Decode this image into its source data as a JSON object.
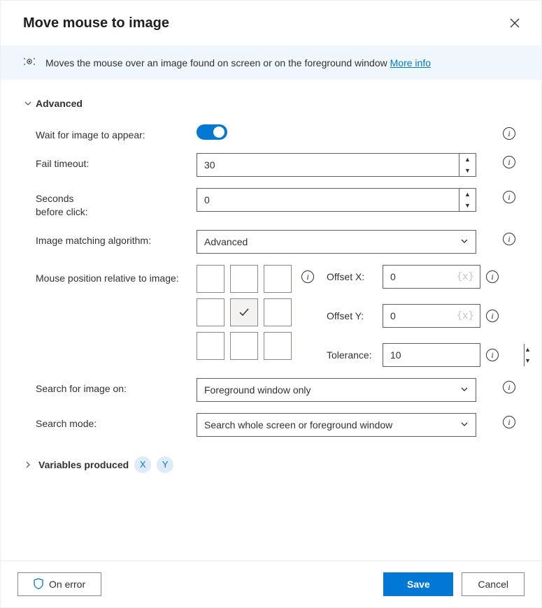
{
  "header": {
    "title": "Move mouse to image"
  },
  "info": {
    "text": "Moves the mouse over an image found on screen or on the foreground window",
    "link_text": "More info"
  },
  "sections": {
    "advanced": "Advanced",
    "variables_produced": "Variables produced"
  },
  "labels": {
    "wait_for_image": "Wait for image to appear:",
    "fail_timeout": "Fail timeout:",
    "seconds_before_click": "Seconds\nbefore click:",
    "image_matching_algorithm": "Image matching algorithm:",
    "mouse_position": "Mouse position relative to image:",
    "offset_x": "Offset X:",
    "offset_y": "Offset Y:",
    "tolerance": "Tolerance:",
    "search_on": "Search for image on:",
    "search_mode": "Search mode:",
    "var_placeholder": "{x}"
  },
  "values": {
    "wait_for_image": true,
    "fail_timeout": "30",
    "seconds_before_click": "0",
    "image_matching_algorithm": "Advanced",
    "mouse_position_index": 4,
    "offset_x": "0",
    "offset_y": "0",
    "tolerance": "10",
    "search_on": "Foreground window only",
    "search_mode": "Search whole screen or foreground window"
  },
  "variables": {
    "x": "X",
    "y": "Y"
  },
  "footer": {
    "on_error": "On error",
    "save": "Save",
    "cancel": "Cancel"
  }
}
